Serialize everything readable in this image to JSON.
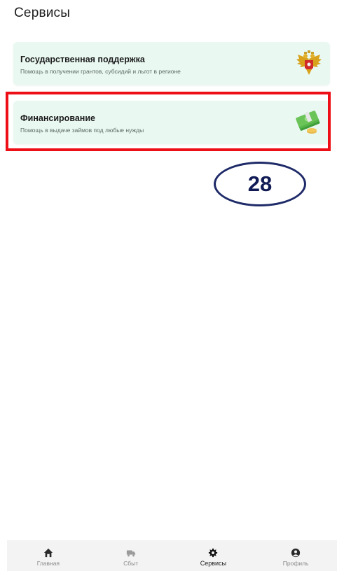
{
  "page_title": "Сервисы",
  "cards": [
    {
      "title": "Государственная поддержка",
      "subtitle": "Помощь в получении грантов, субсидий и льгот в регионе",
      "icon": "coat-of-arms-icon"
    },
    {
      "title": "Финансирование",
      "subtitle": "Помощь в выдаче займов под любые нужды",
      "icon": "money-stack-icon"
    }
  ],
  "annotation": {
    "badge_number": "28",
    "highlight_color": "#ee0f16",
    "badge_color": "#1e2a68"
  },
  "bottom_nav": [
    {
      "label": "Главная",
      "icon": "home-icon",
      "active": false
    },
    {
      "label": "Сбыт",
      "icon": "truck-icon",
      "active": false
    },
    {
      "label": "Сервисы",
      "icon": "gear-icon",
      "active": true
    },
    {
      "label": "Профиль",
      "icon": "profile-icon",
      "active": false
    }
  ],
  "colors": {
    "card_background": "#e9f8f1",
    "nav_background": "#f3f3f3"
  }
}
